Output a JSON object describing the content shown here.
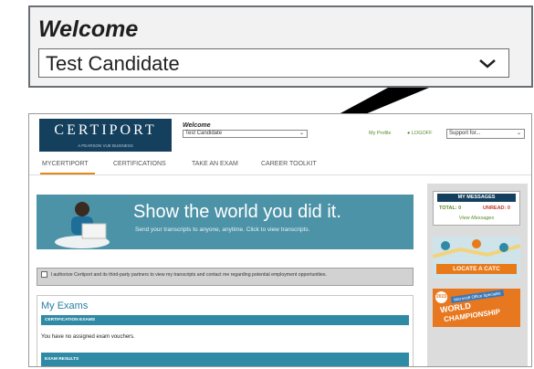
{
  "callout": {
    "label": "Welcome",
    "selected": "Test Candidate"
  },
  "header": {
    "logo_text": "CERTIPORT",
    "logo_sub": "A PEARSON VUE BUSINESS",
    "welcome_label": "Welcome",
    "candidate": "Test Candidate",
    "my_profile": "My Profile",
    "logoff": "LOGOFF",
    "support": "Support for..."
  },
  "nav": {
    "tabs": [
      "MYCERTIPORT",
      "CERTIFICATIONS",
      "TAKE AN EXAM",
      "CAREER TOOLKIT"
    ]
  },
  "banner": {
    "headline": "Show the world you did it.",
    "subtext": "Send your transcripts to anyone, anytime. Click to view transcripts."
  },
  "consent": {
    "text": "I authorize Certiport and its third-party partners to view my transcripts and contact me regarding potential employment opportunities."
  },
  "exams": {
    "title": "My Exams",
    "cert_header": "CERTIFICATION EXAMS",
    "no_vouchers": "You have no assigned exam vouchers.",
    "results_header": "EXAM RESULTS"
  },
  "sidebar": {
    "messages_title": "MY MESSAGES",
    "total": "TOTAL: 0",
    "unread": "UNREAD: 0",
    "view": "View Messages",
    "locate": "LOCATE A CATC",
    "wc_year": "2015",
    "wc_tag": "Microsoft Office Specialist",
    "wc_line1": "WORLD",
    "wc_line2": "CHAMPIONSHIP"
  },
  "colors": {
    "brand_navy": "#14405e",
    "teal": "#2f8aa6",
    "orange": "#e87a1a",
    "green": "#5a8a2a"
  }
}
